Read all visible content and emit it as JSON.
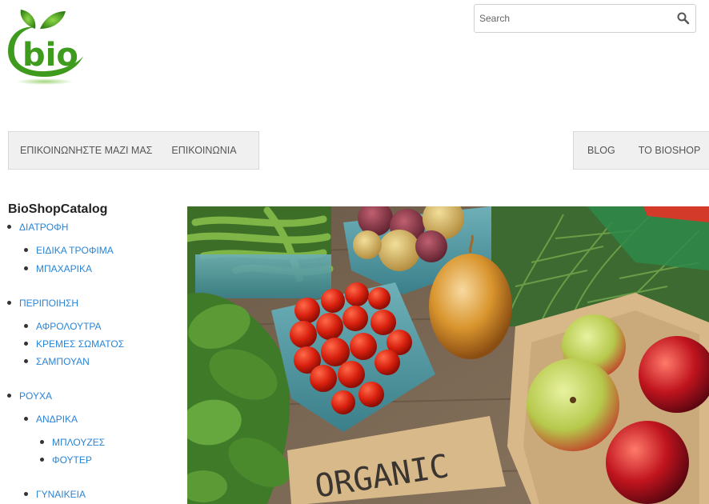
{
  "brand": {
    "logo_text": "bio",
    "logo_icon": "leaf-logo-icon"
  },
  "search": {
    "placeholder": "Search",
    "value": "",
    "icon": "search-icon"
  },
  "nav": {
    "left": [
      "ΕΠΙΚΟΙΝΩΝΗΣΤΕ ΜΑΖΙ ΜΑΣ",
      "ΕΠΙΚΟΙΝΩΝΙΑ"
    ],
    "right": [
      "BLOG",
      "TO BIOSHOP"
    ]
  },
  "catalog": {
    "title": "BioShopCatalog",
    "items": [
      {
        "label": "ΔΙΑΤΡΟΦΗ",
        "level": 0
      },
      {
        "label": "ΕΙΔΙΚΑ ΤΡΟΦΙΜΑ",
        "level": 1
      },
      {
        "label": "ΜΠΑΧΑΡΙΚΑ",
        "level": 1
      },
      {
        "label": "ΠΕΡΙΠΟΙΗΣΗ",
        "level": 0
      },
      {
        "label": "ΑΦΡΟΛΟΥΤΡΑ",
        "level": 1
      },
      {
        "label": "ΚΡΕΜΕΣ ΣΩΜΑΤΟΣ",
        "level": 1
      },
      {
        "label": "ΣΑΜΠΟΥΑΝ",
        "level": 1
      },
      {
        "label": "ΡΟΥΧΑ",
        "level": 0
      },
      {
        "label": "ΑΝΔΡΙΚΑ",
        "level": 1
      },
      {
        "label": "ΜΠΛΟΥΖΕΣ",
        "level": 2
      },
      {
        "label": "ΦΟΥΤΕΡ",
        "level": 2
      },
      {
        "label": "ΓΥΝΑΙΚΕΙΑ",
        "level": 1
      }
    ]
  },
  "hero": {
    "sign_text": "ORGANIC"
  },
  "colors": {
    "link": "#2a84d6",
    "logo_green": "#3f9b1e",
    "nav_bg": "#f0f0f0"
  }
}
